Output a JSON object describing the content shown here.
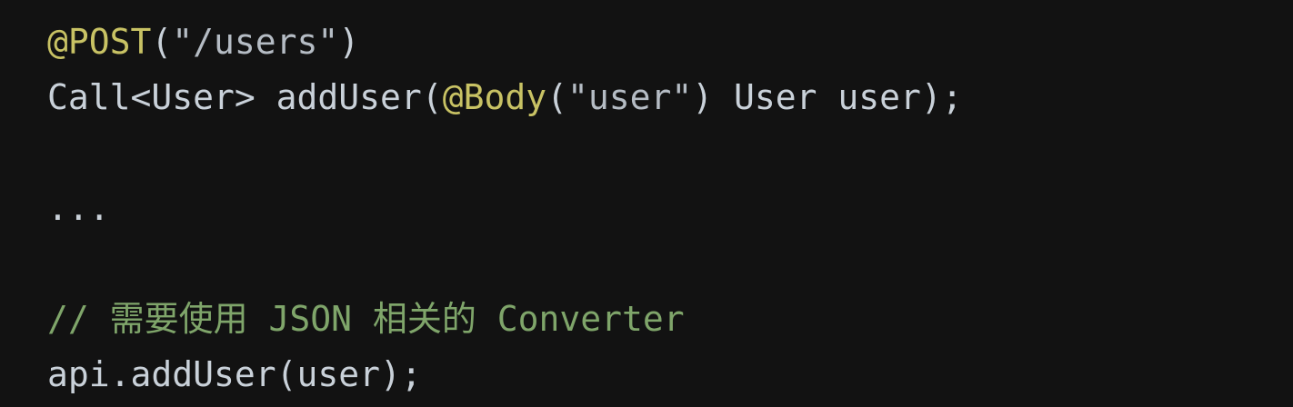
{
  "colors": {
    "background": "#121212",
    "plain": "#c9d1d9",
    "annotation": "#c8c264",
    "comment": "#7fa56a",
    "string": "#b5bcc4"
  },
  "code": {
    "line1": {
      "annotation": "@POST",
      "open": "(",
      "string": "\"/users\"",
      "close": ")"
    },
    "line2": {
      "prefix": "Call<User> addUser(",
      "annotation": "@Body",
      "open": "(",
      "string": "\"user\"",
      "suffix": ") User user);"
    },
    "line3": "",
    "line4": "...",
    "line5": "",
    "line6": "// 需要使用 JSON 相关的 Converter",
    "line7": "api.addUser(user);"
  }
}
